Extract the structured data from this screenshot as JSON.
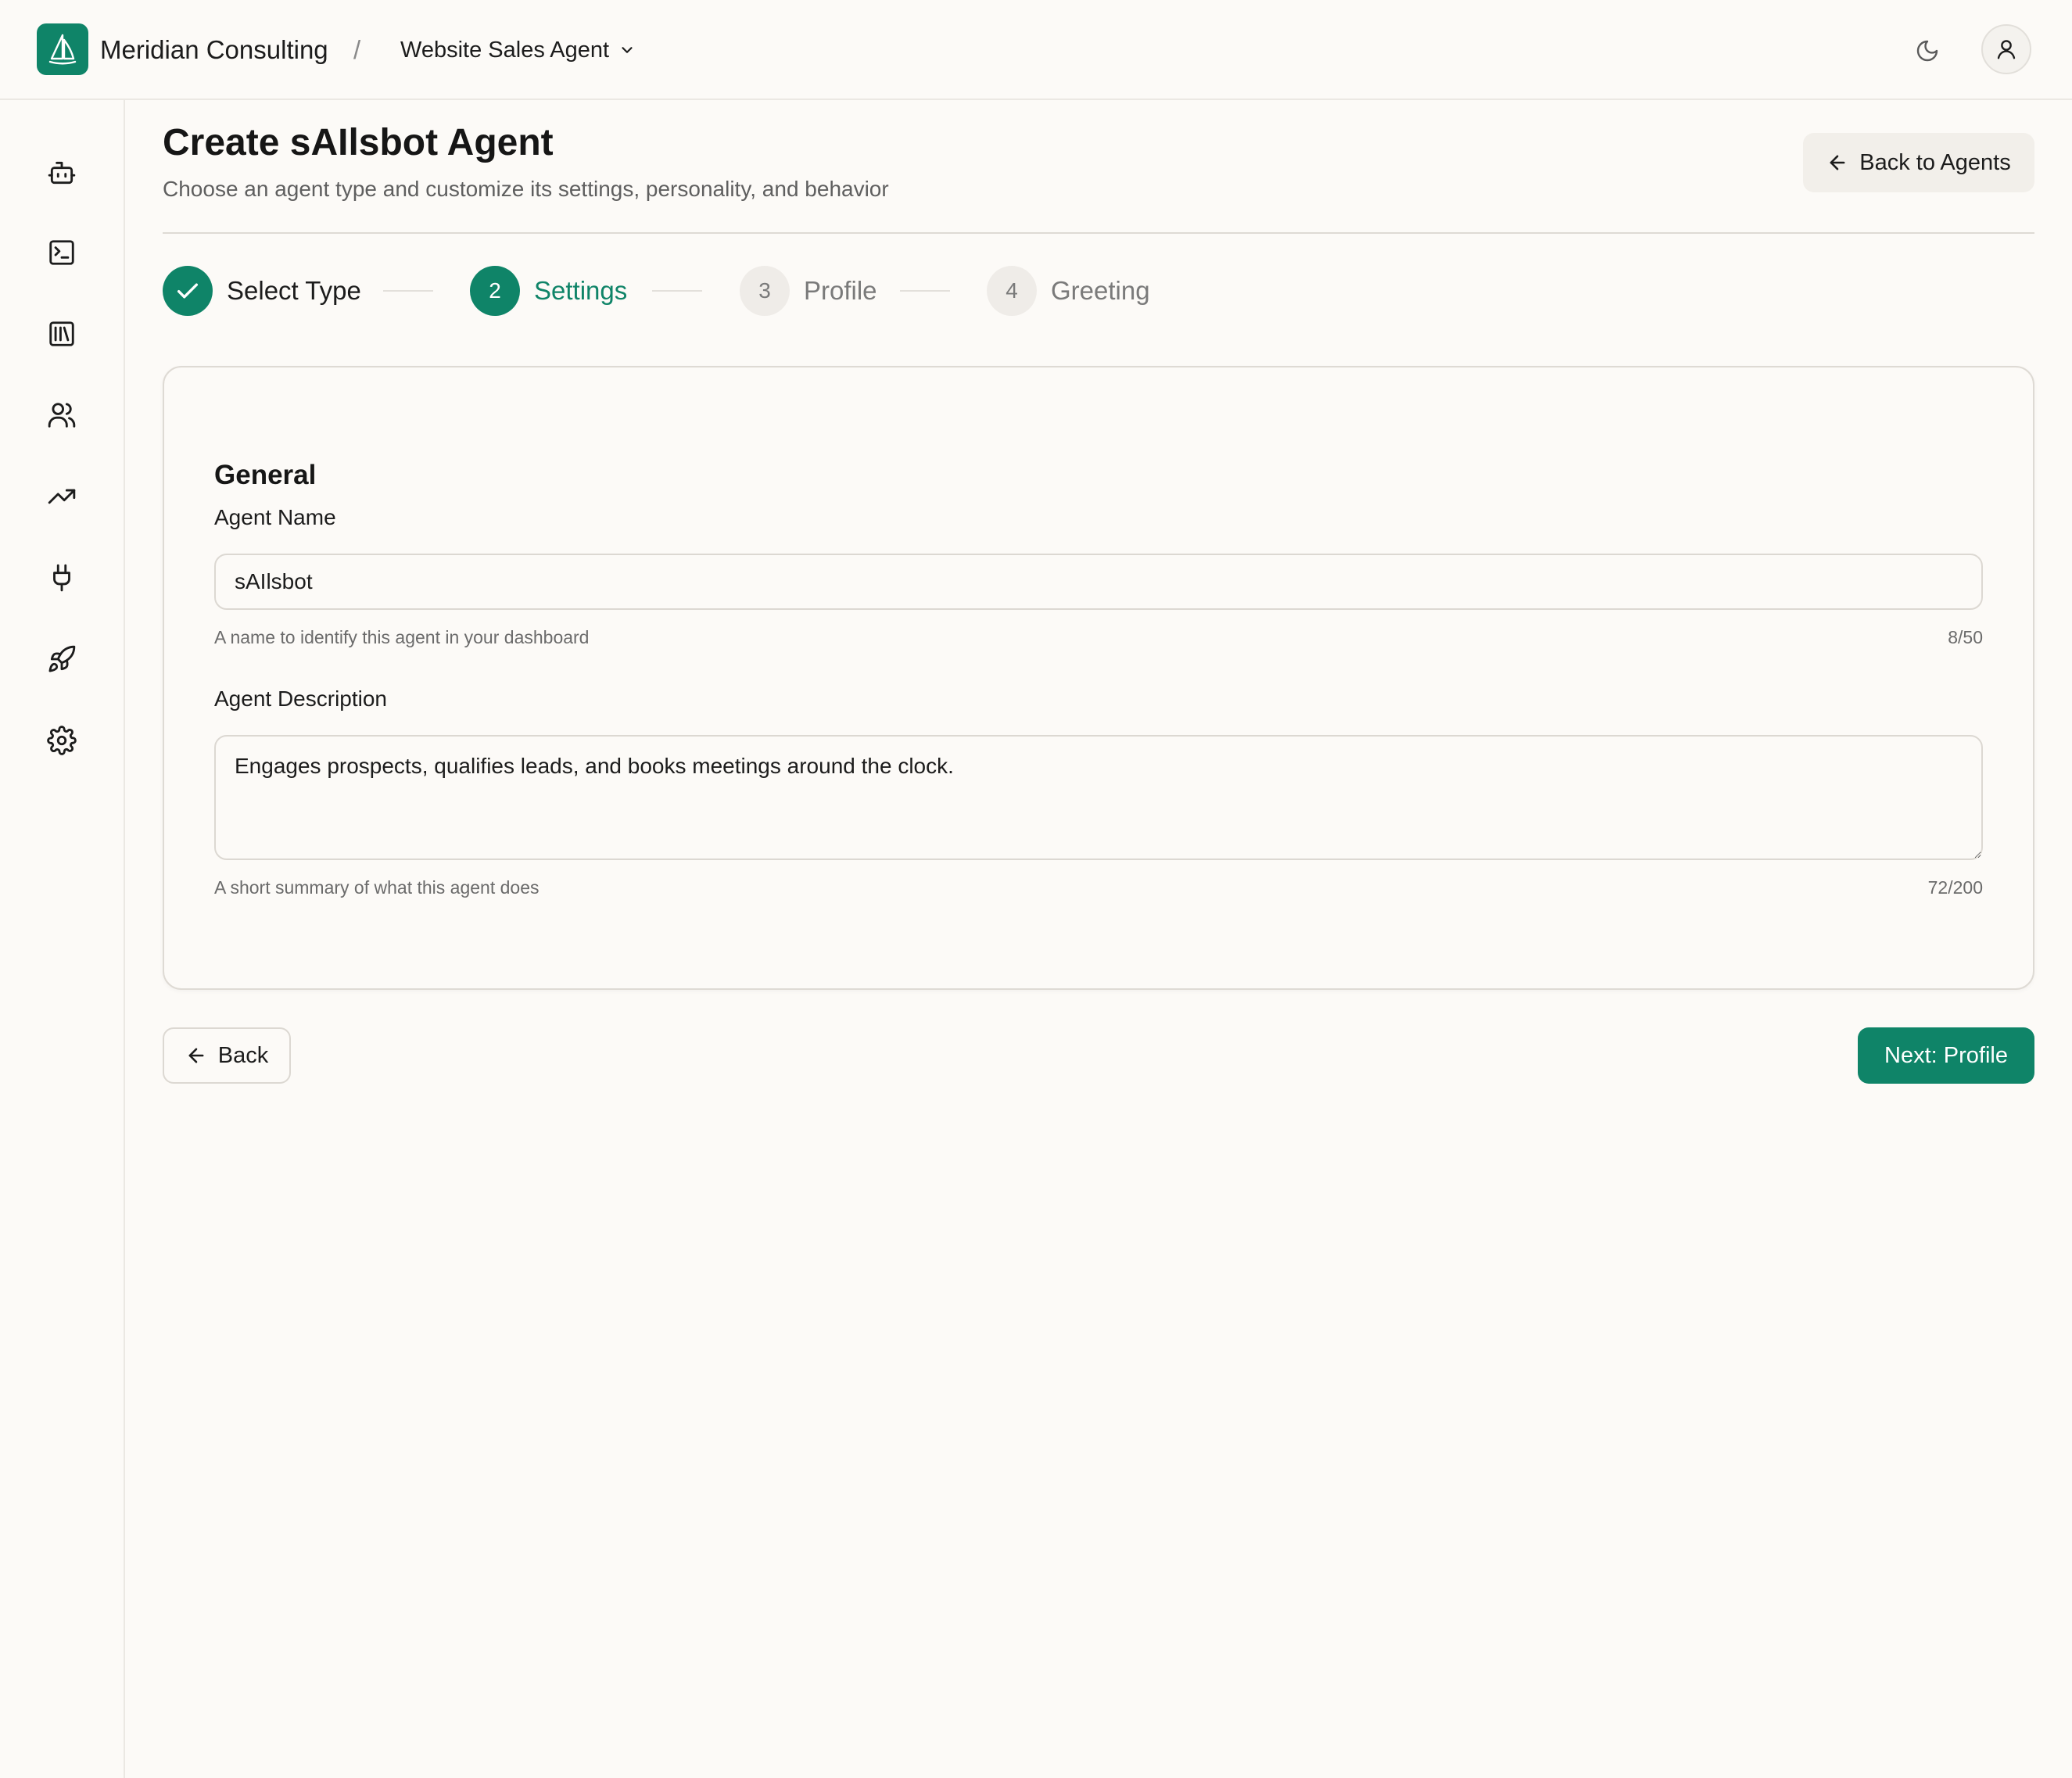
{
  "header": {
    "org_name": "Meridian Consulting",
    "separator": "/",
    "agent_selector": "Website Sales Agent",
    "icons": [
      "logo-sail-icon",
      "chevron-down-icon",
      "moon-icon",
      "user-icon"
    ]
  },
  "sidebar": {
    "items": [
      {
        "icon": "bot-icon"
      },
      {
        "icon": "terminal-icon"
      },
      {
        "icon": "library-icon"
      },
      {
        "icon": "users-icon"
      },
      {
        "icon": "trending-up-icon"
      },
      {
        "icon": "plug-icon"
      },
      {
        "icon": "rocket-icon"
      },
      {
        "icon": "gear-icon"
      }
    ]
  },
  "page": {
    "title": "Create sAIlsbot Agent",
    "subtitle": "Choose an agent type and customize its settings, personality, and behavior",
    "back_to_agents": "Back to Agents"
  },
  "stepper": {
    "steps": [
      {
        "number": "1",
        "label": "Select Type",
        "state": "done"
      },
      {
        "number": "2",
        "label": "Settings",
        "state": "active"
      },
      {
        "number": "3",
        "label": "Profile",
        "state": "pending"
      },
      {
        "number": "4",
        "label": "Greeting",
        "state": "pending"
      }
    ]
  },
  "form": {
    "section_title": "General",
    "agent_name": {
      "label": "Agent Name",
      "value": "sAIlsbot",
      "hint": "A name to identify this agent in your dashboard",
      "counter": "8/50"
    },
    "agent_description": {
      "label": "Agent Description",
      "value": "Engages prospects, qualifies leads, and books meetings around the clock.",
      "hint": "A short summary of what this agent does",
      "counter": "72/200"
    }
  },
  "footer": {
    "back_label": "Back",
    "next_label": "Next: Profile"
  },
  "colors": {
    "accent": "#0f8468",
    "background": "#fcfaf7",
    "border": "#dcd8d2"
  }
}
